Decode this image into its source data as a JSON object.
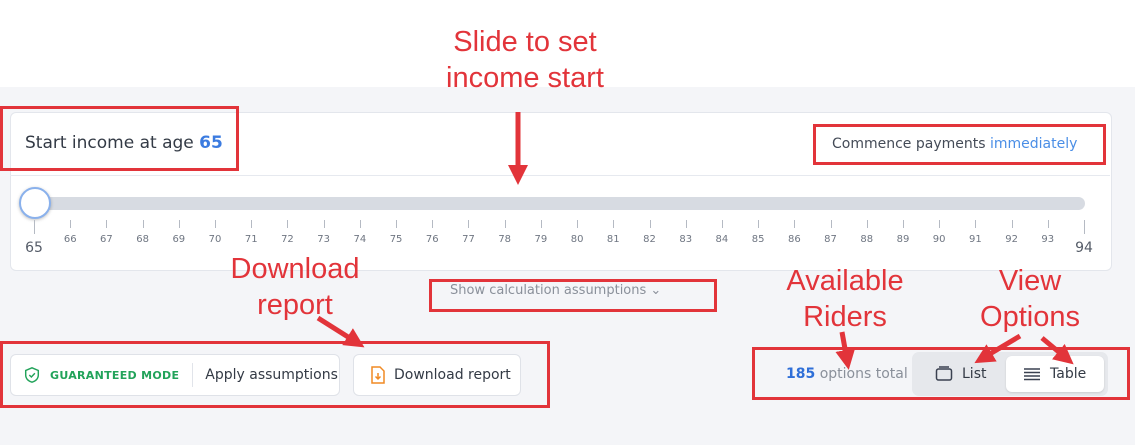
{
  "income": {
    "label": "Start income at age",
    "age": "65"
  },
  "commence": {
    "label": "Commence payments",
    "when": "immediately"
  },
  "slider": {
    "min": 65,
    "max": 94,
    "value": 65,
    "ticks": [
      "65",
      "66",
      "67",
      "68",
      "69",
      "70",
      "71",
      "72",
      "73",
      "74",
      "75",
      "76",
      "77",
      "78",
      "79",
      "80",
      "81",
      "82",
      "83",
      "84",
      "85",
      "86",
      "87",
      "88",
      "89",
      "90",
      "91",
      "92",
      "93",
      "94"
    ]
  },
  "assumptions_link": "Show calculation assumptions",
  "mode": {
    "badge": "GUARANTEED MODE",
    "apply": "Apply assumptions"
  },
  "download": "Download report",
  "options": {
    "count": "185",
    "label": "options total"
  },
  "view": {
    "list": "List",
    "table": "Table",
    "selected": "Table"
  },
  "annotations": {
    "slide_1": "Slide to set",
    "slide_2": "income start",
    "download_1": "Download",
    "download_2": "report",
    "riders_1": "Available",
    "riders_2": "Riders",
    "view_1": "View",
    "view_2": "Options"
  },
  "colors": {
    "annotation": "#e2343a",
    "accent": "#3b7be0",
    "guaranteed": "#22a35a",
    "download_icon": "#f08a24"
  }
}
